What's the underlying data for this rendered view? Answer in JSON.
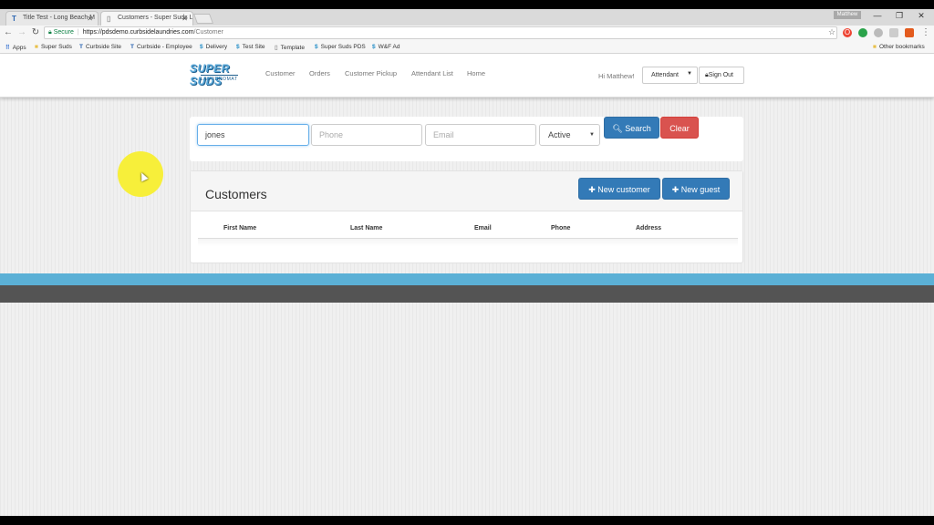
{
  "browser": {
    "tabs": [
      {
        "title": "Title Test - Long Beach M"
      },
      {
        "title": "Customers - Super Suds L"
      }
    ],
    "user_badge": "Matthew",
    "url": {
      "secure_label": "Secure",
      "host": "https://pdsdemo.curbsidelaundries.com",
      "path": "/Customer"
    },
    "bookmarks": [
      {
        "label": "Apps",
        "icon": "apps-grid-icon"
      },
      {
        "label": "Super Suds",
        "icon": "folder-icon"
      },
      {
        "label": "Curbside Site",
        "icon": "curbside-logo-icon"
      },
      {
        "label": "Curbside - Employee",
        "icon": "curbside-logo-icon"
      },
      {
        "label": "Delivery",
        "icon": "dollar-icon"
      },
      {
        "label": "Test Site",
        "icon": "dollar-icon"
      },
      {
        "label": "Template",
        "icon": "page-icon"
      },
      {
        "label": "Super Suds PDS",
        "icon": "dollar-icon"
      },
      {
        "label": "W&F Ad",
        "icon": "dollar-icon"
      }
    ],
    "other_bookmarks": "Other bookmarks"
  },
  "app": {
    "logo_line1": "SUPER SUDS",
    "logo_line2": "LAUNDROMAT",
    "nav": [
      "Customer",
      "Orders",
      "Customer Pickup",
      "Attendant List",
      "Home"
    ],
    "greeting": "Hi Matthew!",
    "role": "Attendant",
    "sign_out": "Sign Out"
  },
  "search": {
    "name_value": "jones",
    "phone_placeholder": "Phone",
    "email_placeholder": "Email",
    "status_value": "Active",
    "search_label": "Search",
    "clear_label": "Clear"
  },
  "customers": {
    "title": "Customers",
    "new_customer_label": "New customer",
    "new_guest_label": "New guest",
    "columns": [
      "First Name",
      "Last Name",
      "Email",
      "Phone",
      "Address"
    ]
  },
  "colors": {
    "primary": "#337ab7",
    "danger": "#d9534f",
    "footer_blue": "#5bb0d6",
    "footer_gray": "#545454"
  }
}
